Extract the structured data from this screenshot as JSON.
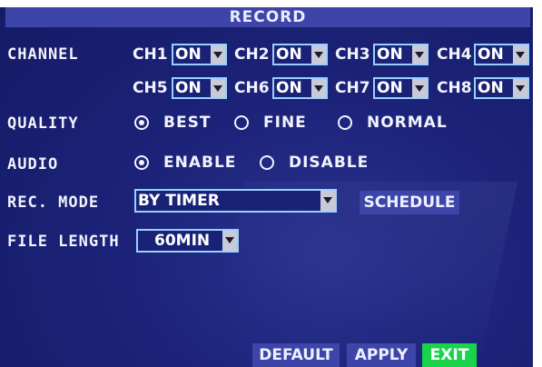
{
  "title": "RECORD",
  "channel": {
    "label": "CHANNEL",
    "items": [
      {
        "name": "CH1",
        "value": "ON"
      },
      {
        "name": "CH2",
        "value": "ON"
      },
      {
        "name": "CH3",
        "value": "ON"
      },
      {
        "name": "CH4",
        "value": "ON"
      },
      {
        "name": "CH5",
        "value": "ON"
      },
      {
        "name": "CH6",
        "value": "ON"
      },
      {
        "name": "CH7",
        "value": "ON"
      },
      {
        "name": "CH8",
        "value": "ON"
      }
    ]
  },
  "quality": {
    "label": "QUALITY",
    "options": [
      "BEST",
      "FINE",
      "NORMAL"
    ],
    "selected": "BEST"
  },
  "audio": {
    "label": "AUDIO",
    "options": [
      "ENABLE",
      "DISABLE"
    ],
    "selected": "ENABLE"
  },
  "rec_mode": {
    "label": "REC. MODE",
    "value": "BY TIMER",
    "schedule_button": "SCHEDULE"
  },
  "file_length": {
    "label": "FILE LENGTH",
    "value": "60MIN"
  },
  "buttons": {
    "default": "DEFAULT",
    "apply": "APPLY",
    "exit": "EXIT"
  },
  "colors": {
    "background": "#1c2278",
    "titlebar": "#3d45a8",
    "exit_active": "#19d44a",
    "field_border": "#9ad0ff"
  }
}
